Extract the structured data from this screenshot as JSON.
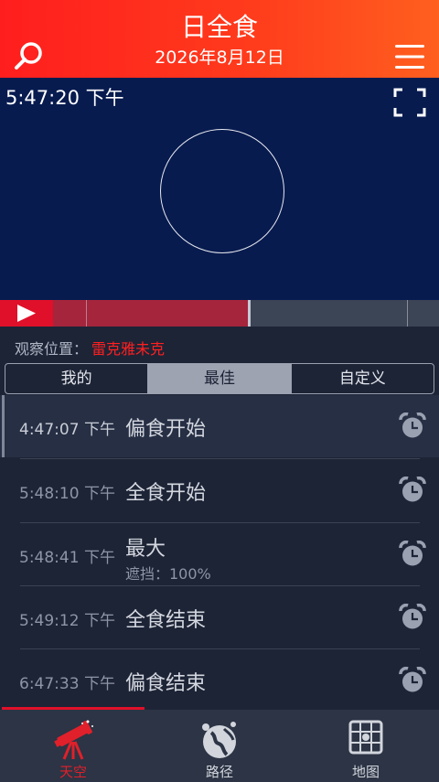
{
  "header": {
    "title": "日全食",
    "date": "2026年8月12日"
  },
  "sky": {
    "time": "5:47:20 下午"
  },
  "location": {
    "label": "观察位置：",
    "place": "雷克雅未克"
  },
  "tabs": [
    {
      "label": "我的",
      "active": false
    },
    {
      "label": "最佳",
      "active": true
    },
    {
      "label": "自定义",
      "active": false
    }
  ],
  "events": [
    {
      "time": "4:47:07 下午",
      "name": "偏食开始",
      "sub": ""
    },
    {
      "time": "5:48:10 下午",
      "name": "全食开始",
      "sub": ""
    },
    {
      "time": "5:48:41 下午",
      "name": "最大",
      "sub": "遮挡：100%"
    },
    {
      "time": "5:49:12 下午",
      "name": "全食结束",
      "sub": ""
    },
    {
      "time": "6:47:33 下午",
      "name": "偏食结束",
      "sub": ""
    }
  ],
  "nav": [
    {
      "label": "天空",
      "icon": "telescope-icon",
      "active": true
    },
    {
      "label": "路径",
      "icon": "globe-path-icon",
      "active": false
    },
    {
      "label": "地图",
      "icon": "map-grid-icon",
      "active": false
    }
  ],
  "colors": {
    "accent": "#e0102a",
    "sky": "#071b4f",
    "background": "#1d2436"
  }
}
